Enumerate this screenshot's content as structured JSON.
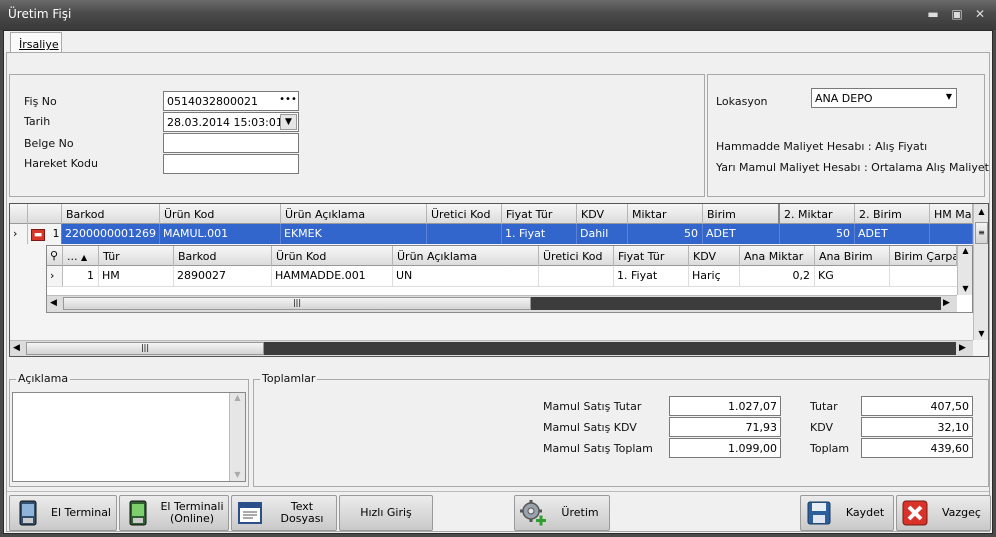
{
  "window": {
    "title": "Üretim Fişi"
  },
  "tabs": [
    {
      "label": "İrsaliye"
    }
  ],
  "form": {
    "fis_no_label": "Fiş No",
    "fis_no_value": "0514032800021",
    "tarih_label": "Tarih",
    "tarih_value": "28.03.2014 15:03:01",
    "belge_no_label": "Belge No",
    "belge_no_value": "",
    "hareket_kodu_label": "Hareket Kodu",
    "hareket_kodu_value": ""
  },
  "location": {
    "label": "Lokasyon",
    "value": "ANA DEPO",
    "line1": "Hammadde Maliyet Hesabı : Alış Fiyatı",
    "line2": "Yarı Mamul Maliyet Hesabı : Ortalama Alış Maliyet"
  },
  "main_grid": {
    "columns": [
      "Barkod",
      "Ürün Kod",
      "Ürün Açıklama",
      "Üretici Kod",
      "Fiyat Tür",
      "KDV",
      "Miktar",
      "Birim",
      "2. Miktar",
      "2. Birim",
      "HM Mali"
    ],
    "row": {
      "num": "1",
      "barkod": "2200000001269",
      "urun_kod": "MAMUL.001",
      "aciklama": "EKMEK",
      "uretici": "",
      "fiyat_tur": "1. Fiyat",
      "kdv": "Dahil",
      "miktar": "50",
      "birim": "ADET",
      "miktar2": "50",
      "birim2": "ADET"
    }
  },
  "detail_grid": {
    "columns": [
      "...",
      "Tür",
      "Barkod",
      "Ürün Kod",
      "Ürün Açıklama",
      "Üretici Kod",
      "Fiyat Tür",
      "KDV",
      "Ana Miktar",
      "Ana Birim",
      "Birim Çarpan"
    ],
    "row": {
      "num": "1",
      "tur": "HM",
      "barkod": "2890027",
      "urun_kod": "HAMMADDE.001",
      "aciklama": "UN",
      "uretici": "",
      "fiyat_tur": "1. Fiyat",
      "kdv": "Hariç",
      "ana_miktar": "0,2",
      "ana_birim": "KG",
      "carpan": ""
    }
  },
  "aciklama": {
    "label": "Açıklama",
    "value": ""
  },
  "toplamlar": {
    "label": "Toplamlar",
    "mamul_satis_tutar_label": "Mamul Satış Tutar",
    "mamul_satis_tutar": "1.027,07",
    "mamul_satis_kdv_label": "Mamul Satış KDV",
    "mamul_satis_kdv": "71,93",
    "mamul_satis_toplam_label": "Mamul Satış Toplam",
    "mamul_satis_toplam": "1.099,00",
    "tutar_label": "Tutar",
    "tutar": "407,50",
    "kdv_label": "KDV",
    "kdv": "32,10",
    "toplam_label": "Toplam",
    "toplam": "439,60"
  },
  "buttons": {
    "el_terminal": "El Terminal",
    "el_terminali_online_1": "El Terminali",
    "el_terminali_online_2": "(Online)",
    "text_dosyasi": "Text Dosyası",
    "hizli_giris": "Hızlı Giriş",
    "uretim": "Üretim",
    "kaydet": "Kaydet",
    "vazgec": "Vazgeç"
  },
  "window_controls": {
    "minimize": "▬",
    "maximize": "▣",
    "close": "✕"
  },
  "icons": [
    "ellipsis-icon",
    "dropdown-arrow-icon",
    "row-expand-icon",
    "row-collapse-icon",
    "search-icon",
    "sort-asc-icon",
    "pda-icon",
    "pda-online-icon",
    "text-file-icon",
    "gear-add-icon",
    "save-icon",
    "cancel-icon"
  ]
}
